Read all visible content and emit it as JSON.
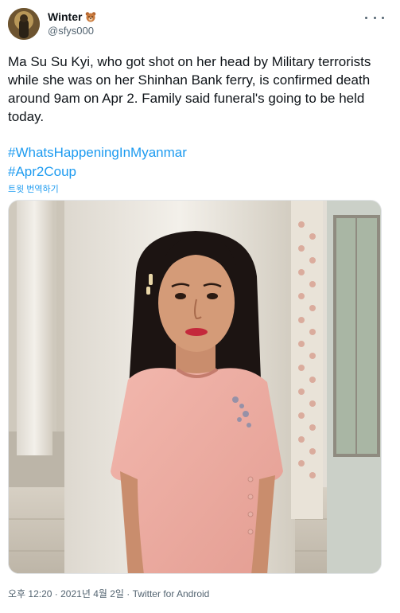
{
  "author": {
    "display_name": "Winter",
    "name_emoji_icon": "bear-face-icon",
    "handle": "@sfys000",
    "avatar_icon": "avatar-photo"
  },
  "menu": {
    "more_icon": "more-horizontal-icon"
  },
  "tweet": {
    "text": "Ma Su Su Kyi, who got shot on her head by Military terrorists while she was on her Shinhan Bank ferry, is confirmed death around 9am on Apr 2. Family said funeral's going to be held today.",
    "hashtags": [
      "#WhatsHappeningInMyanmar",
      "#Apr2Coup"
    ],
    "translate_label": "트윗 번역하기"
  },
  "media": {
    "icon": "photo-woman-pink-top"
  },
  "meta": {
    "time": "오후 12:20",
    "separator": " · ",
    "date": "2021년 4월 2일",
    "source": "Twitter for Android"
  },
  "colors": {
    "link": "#1d9bf0",
    "text": "#0f1419",
    "secondary": "#536471"
  }
}
